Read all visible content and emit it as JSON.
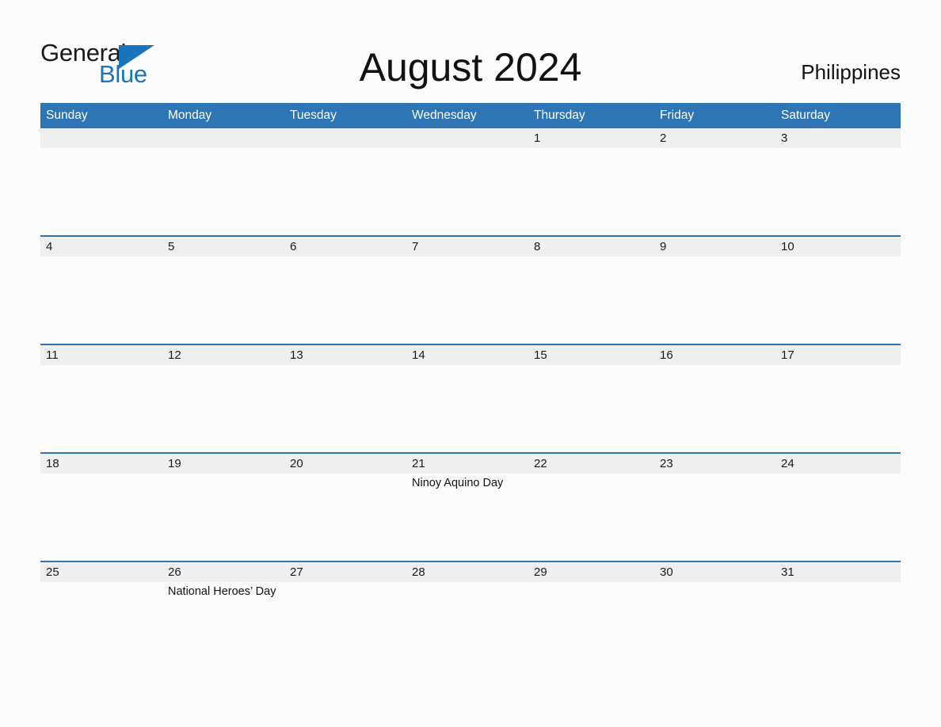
{
  "branding": {
    "logo_text_1": "General",
    "logo_text_2": "Blue",
    "logo_color": "#1a74bb"
  },
  "header": {
    "title": "August 2024",
    "region": "Philippines",
    "header_bar_color": "#2e75b6"
  },
  "weekdays": [
    "Sunday",
    "Monday",
    "Tuesday",
    "Wednesday",
    "Thursday",
    "Friday",
    "Saturday"
  ],
  "weeks": [
    {
      "days": [
        {
          "date": "",
          "event": ""
        },
        {
          "date": "",
          "event": ""
        },
        {
          "date": "",
          "event": ""
        },
        {
          "date": "",
          "event": ""
        },
        {
          "date": "1",
          "event": ""
        },
        {
          "date": "2",
          "event": ""
        },
        {
          "date": "3",
          "event": ""
        }
      ]
    },
    {
      "days": [
        {
          "date": "4",
          "event": ""
        },
        {
          "date": "5",
          "event": ""
        },
        {
          "date": "6",
          "event": ""
        },
        {
          "date": "7",
          "event": ""
        },
        {
          "date": "8",
          "event": ""
        },
        {
          "date": "9",
          "event": ""
        },
        {
          "date": "10",
          "event": ""
        }
      ]
    },
    {
      "days": [
        {
          "date": "11",
          "event": ""
        },
        {
          "date": "12",
          "event": ""
        },
        {
          "date": "13",
          "event": ""
        },
        {
          "date": "14",
          "event": ""
        },
        {
          "date": "15",
          "event": ""
        },
        {
          "date": "16",
          "event": ""
        },
        {
          "date": "17",
          "event": ""
        }
      ]
    },
    {
      "days": [
        {
          "date": "18",
          "event": ""
        },
        {
          "date": "19",
          "event": ""
        },
        {
          "date": "20",
          "event": ""
        },
        {
          "date": "21",
          "event": "Ninoy Aquino Day"
        },
        {
          "date": "22",
          "event": ""
        },
        {
          "date": "23",
          "event": ""
        },
        {
          "date": "24",
          "event": ""
        }
      ]
    },
    {
      "days": [
        {
          "date": "25",
          "event": ""
        },
        {
          "date": "26",
          "event": "National Heroes’ Day"
        },
        {
          "date": "27",
          "event": ""
        },
        {
          "date": "28",
          "event": ""
        },
        {
          "date": "29",
          "event": ""
        },
        {
          "date": "30",
          "event": ""
        },
        {
          "date": "31",
          "event": ""
        }
      ]
    }
  ]
}
